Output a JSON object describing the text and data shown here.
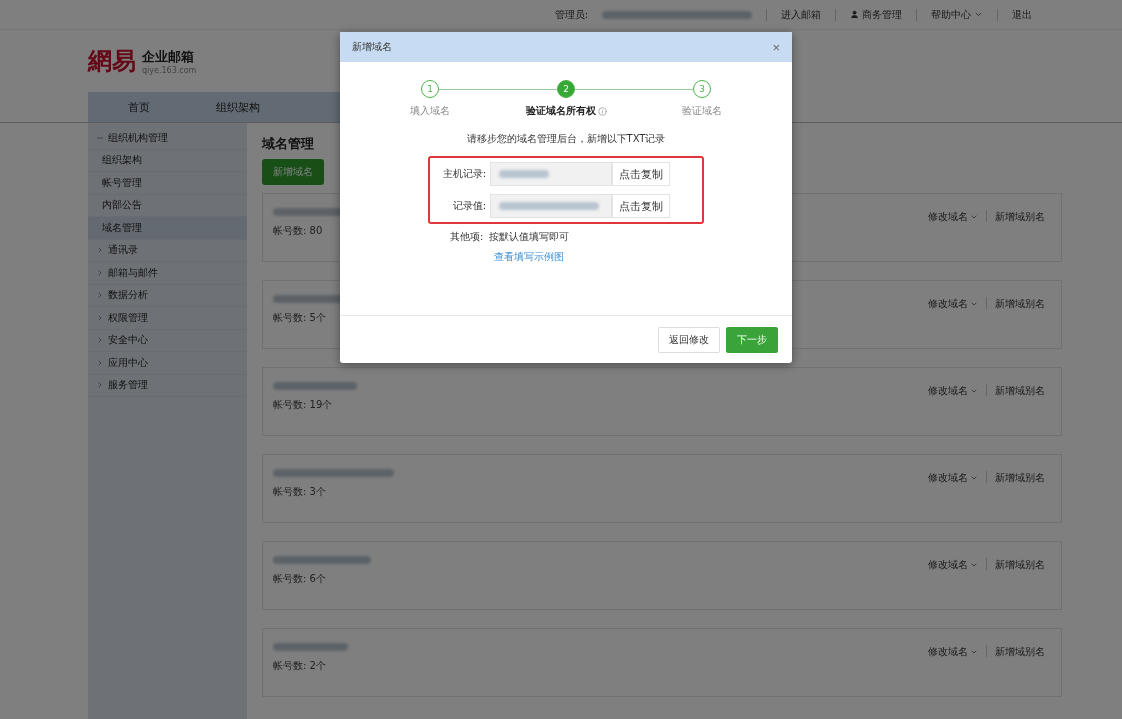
{
  "top_bar": {
    "admin_label": "管理员:",
    "links": [
      "进入邮箱",
      "商务管理",
      "帮助中心",
      "退出"
    ]
  },
  "logo": {
    "brand": "網易",
    "product": "企业邮箱",
    "site": "qiye.163.com"
  },
  "nav": {
    "tabs": [
      {
        "label": "首页",
        "selected": false
      },
      {
        "label": "组织架构",
        "selected": false
      }
    ]
  },
  "sidebar": {
    "items": [
      {
        "label": "组织机构管理",
        "expanded": true,
        "children": [
          {
            "label": "组织架构",
            "selected": false
          },
          {
            "label": "帐号管理",
            "selected": false
          },
          {
            "label": "内部公告",
            "selected": false
          },
          {
            "label": "域名管理",
            "selected": true
          }
        ]
      },
      {
        "label": "通讯录",
        "expanded": false
      },
      {
        "label": "邮箱与邮件",
        "expanded": false
      },
      {
        "label": "数据分析",
        "expanded": false
      },
      {
        "label": "权限管理",
        "expanded": false
      },
      {
        "label": "安全中心",
        "expanded": false
      },
      {
        "label": "应用中心",
        "expanded": false
      },
      {
        "label": "服务管理",
        "expanded": false
      }
    ]
  },
  "content": {
    "title": "域名管理",
    "add_button": "新增域名",
    "domains": [
      {
        "count_label": "帐号数:",
        "count": "80",
        "actions": [
          "修改域名",
          "新增域别名"
        ]
      },
      {
        "count_label": "帐号数:",
        "count": "5个",
        "actions": [
          "修改域名",
          "新增域别名"
        ]
      },
      {
        "count_label": "帐号数:",
        "count": "19个",
        "actions": [
          "修改域名",
          "新增域别名"
        ]
      },
      {
        "count_label": "帐号数:",
        "count": "3个",
        "actions": [
          "修改域名",
          "新增域别名"
        ]
      },
      {
        "count_label": "帐号数:",
        "count": "6个",
        "actions": [
          "修改域名",
          "新增域别名"
        ]
      },
      {
        "count_label": "帐号数:",
        "count": "2个",
        "actions": [
          "修改域名",
          "新增域别名"
        ]
      }
    ]
  },
  "dialog": {
    "title": "新增域名",
    "close": "×",
    "steps": [
      {
        "number": "1",
        "label": "填入域名",
        "selected": false
      },
      {
        "number": "2",
        "label": "验证域名所有权",
        "selected": true
      },
      {
        "number": "3",
        "label": "验证域名",
        "selected": false
      }
    ],
    "instruction": "请移步您的域名管理后台，新增以下TXT记录",
    "records": [
      {
        "label": "主机记录:",
        "copy": "点击复制"
      },
      {
        "label": "记录值:",
        "copy": "点击复制"
      }
    ],
    "other_label": "其他项:",
    "other_value": "按默认值填写即可",
    "example_link": "查看填写示例图",
    "buttons": [
      {
        "label": "返回修改",
        "kind": "secondary"
      },
      {
        "label": "下一步",
        "kind": "primary"
      }
    ]
  }
}
